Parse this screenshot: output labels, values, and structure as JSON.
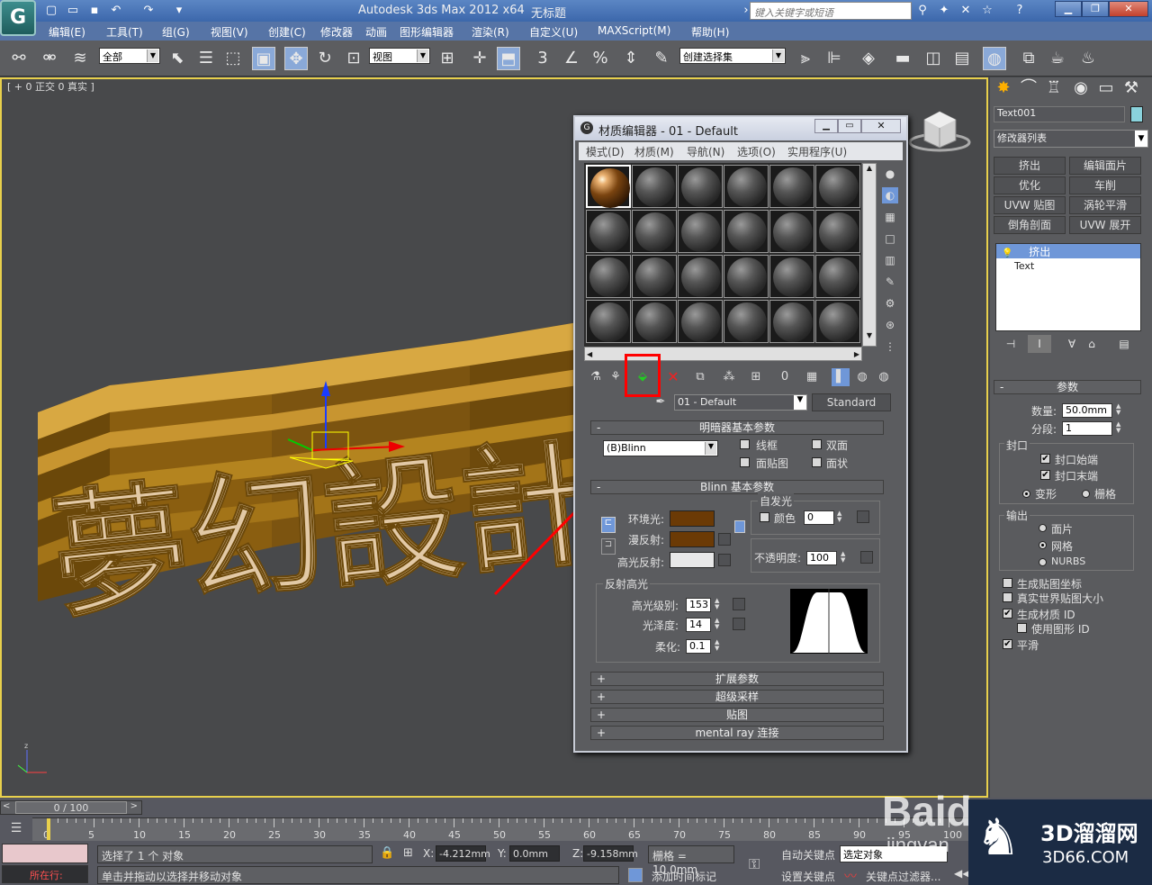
{
  "app": {
    "title": "Autodesk 3ds Max  2012 x64",
    "doc_title": "无标题",
    "search_placeholder": "键入关键字或短语",
    "logo_glyph": "G"
  },
  "menubar": {
    "items": [
      "编辑(E)",
      "工具(T)",
      "组(G)",
      "视图(V)",
      "创建(C)",
      "修改器",
      "动画",
      "图形编辑器",
      "渲染(R)",
      "自定义(U)",
      "MAXScript(M)",
      "帮助(H)"
    ]
  },
  "toolbar": {
    "selection_filter": "全部",
    "ref_coord": "视图",
    "named_selection": "创建选择集",
    "snap_3": "3",
    "snap_percent": "%"
  },
  "viewport": {
    "label": "[ + 0 正交 0 真实 ]",
    "scene_text": "夢幻設計師"
  },
  "material_editor": {
    "title": "材质编辑器 - 01 - Default",
    "menu": [
      "模式(D)",
      "材质(M)",
      "导航(N)",
      "选项(O)",
      "实用程序(U)"
    ],
    "material_name": "01 - Default",
    "material_type": "Standard",
    "shader_rollout": "明暗器基本参数",
    "shader": "(B)Blinn",
    "shader_opts": {
      "wire": "线框",
      "two_sided": "双面",
      "face_map": "面贴图",
      "faceted": "面状"
    },
    "blinn_rollout": "Blinn 基本参数",
    "self_illum": "自发光",
    "color_label": "颜色",
    "color_value": "0",
    "ambient_label": "环境光:",
    "diffuse_label": "漫反射:",
    "specular_label": "高光反射:",
    "ambient_color": "#6b3a05",
    "diffuse_color": "#6b3a05",
    "specular_color": "#e8e8e8",
    "opacity_label": "不透明度:",
    "opacity_value": "100",
    "highlights_label": "反射高光",
    "spec_level_label": "高光级别:",
    "spec_level": "153",
    "gloss_label": "光泽度:",
    "gloss": "14",
    "soften_label": "柔化:",
    "soften": "0.1",
    "rollouts": [
      "扩展参数",
      "超级采样",
      "贴图",
      "mental ray 连接"
    ]
  },
  "command_panel": {
    "object_name": "Text001",
    "modifier_list": "修改器列表",
    "buttons": [
      "挤出",
      "编辑面片",
      "优化",
      "车削",
      "UVW 贴图",
      "涡轮平滑",
      "倒角剖面",
      "UVW 展开"
    ],
    "stack": [
      "挤出",
      "Text"
    ],
    "params_title": "参数",
    "amount_label": "数量:",
    "amount_value": "50.0mm",
    "segments_label": "分段:",
    "segments_value": "1",
    "capping_label": "封口",
    "cap_start": "封口始端",
    "cap_end": "封口末端",
    "morph": "变形",
    "grid": "栅格",
    "output_label": "输出",
    "patch": "面片",
    "mesh": "网格",
    "nurbs": "NURBS",
    "gen_mapping": "生成贴图坐标",
    "real_world": "真实世界贴图大小",
    "gen_mat_id": "生成材质 ID",
    "use_shape_id": "使用图形 ID",
    "smooth": "平滑"
  },
  "bottom": {
    "timeslider": "0 / 100",
    "ticks": [
      "0",
      "5",
      "10",
      "15",
      "20",
      "25",
      "30",
      "35",
      "40",
      "45",
      "50",
      "55",
      "60",
      "65",
      "70",
      "75",
      "80",
      "85",
      "90",
      "95",
      "100"
    ],
    "status1": "选择了 1 个 对象",
    "status2": "单击并拖动以选择并移动对象",
    "running": "所在行:",
    "x_label": "X:",
    "x_value": "-4.212mm",
    "y_label": "Y:",
    "y_value": "0.0mm",
    "z_label": "Z:",
    "z_value": "-9.158mm",
    "grid": "栅格 = 10.0mm",
    "auto_key": "自动关键点",
    "set_key": "设置关键点",
    "selected": "选定对象",
    "key_filters": "关键点过滤器...",
    "add_time_tag": "添加时间标记"
  },
  "watermarks": {
    "baidu": "Baidu",
    "jingyan": "jingyan",
    "brand_cn": "3D溜溜网",
    "brand_url": "3D66.COM"
  },
  "colors": {
    "title_blue": "#4a77b8",
    "highlight_red": "#ff0000",
    "gold_text": "#a97a1a",
    "face_text": "#e2c9a6"
  }
}
